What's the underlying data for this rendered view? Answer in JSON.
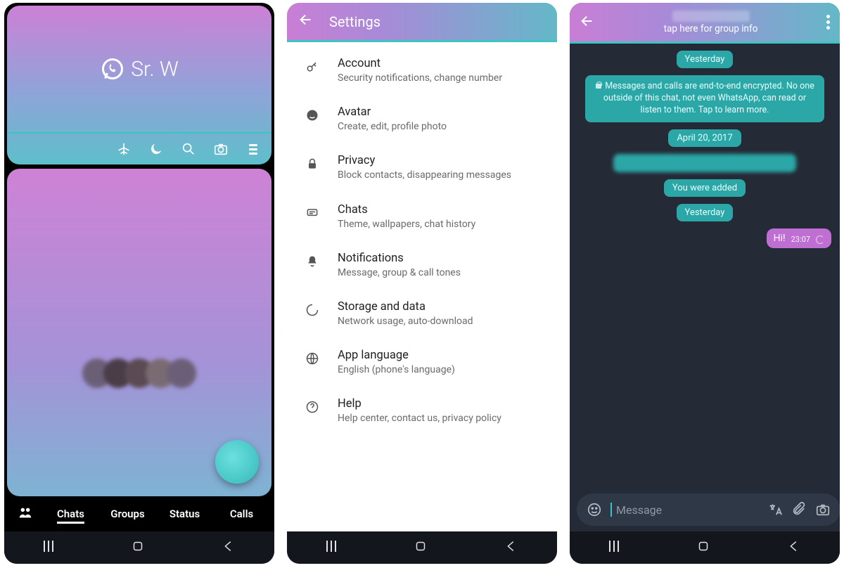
{
  "screen1": {
    "brand": "Sr. W",
    "tabs": [
      "Chats",
      "Groups",
      "Status",
      "Calls"
    ],
    "active_tab": 0
  },
  "screen2": {
    "title": "Settings",
    "items": [
      {
        "icon": "key-icon",
        "title": "Account",
        "sub": "Security notifications, change number"
      },
      {
        "icon": "avatar-icon",
        "title": "Avatar",
        "sub": "Create, edit, profile photo"
      },
      {
        "icon": "lock-icon",
        "title": "Privacy",
        "sub": "Block contacts, disappearing messages"
      },
      {
        "icon": "chat-icon",
        "title": "Chats",
        "sub": "Theme, wallpapers, chat history"
      },
      {
        "icon": "bell-icon",
        "title": "Notifications",
        "sub": "Message, group & call tones"
      },
      {
        "icon": "spinner-icon",
        "title": "Storage and data",
        "sub": "Network usage, auto-download"
      },
      {
        "icon": "globe-icon",
        "title": "App language",
        "sub": "English (phone's language)"
      },
      {
        "icon": "help-icon",
        "title": "Help",
        "sub": "Help center, contact us, privacy policy"
      }
    ]
  },
  "screen3": {
    "subtitle": "tap here for group info",
    "chips": {
      "d1": "Yesterday",
      "encryption": "Messages and calls are end-to-end encrypted. No one outside of this chat, not even WhatsApp, can read or listen to them. Tap to learn more.",
      "d2": "April 20, 2017",
      "added": "You were added",
      "d3": "Yesterday"
    },
    "out_msg": {
      "text": "Hi!",
      "time": "23:07"
    },
    "composer": {
      "placeholder": "Message"
    }
  }
}
